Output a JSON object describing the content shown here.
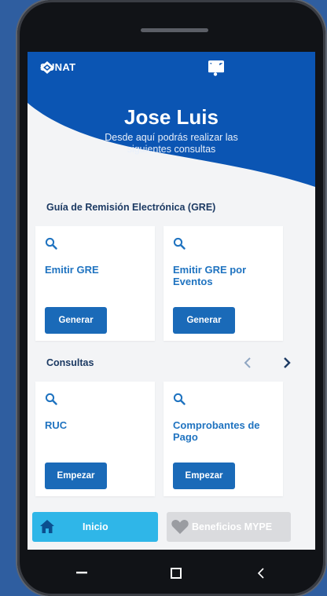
{
  "app": {
    "brand": "SUNAT"
  },
  "header": {
    "user_name": "Jose Luis",
    "subtitle": "Desde aquí podrás realizar las siguientes consultas"
  },
  "gre_section": {
    "title": "Guía de Remisión Electrónica (GRE)",
    "cards": [
      {
        "title": "Emitir GRE",
        "button": "Generar",
        "icon": "search-icon"
      },
      {
        "title": "Emitir GRE por Eventos",
        "button": "Generar",
        "icon": "search-icon"
      }
    ]
  },
  "consultas_section": {
    "title": "Consultas",
    "cards": [
      {
        "title": "RUC",
        "button": "Empezar",
        "icon": "search-icon"
      },
      {
        "title": "Comprobantes de Pago",
        "button": "Empezar",
        "icon": "search-icon"
      }
    ]
  },
  "bottom_tabs": {
    "inicio": "Inicio",
    "mype": "Beneficios MYPE"
  },
  "colors": {
    "primary_blue": "#0b55b3",
    "accent_cyan": "#2fb6e8",
    "button_blue": "#1a6ab8",
    "title_blue": "#1f73c0",
    "section_navy": "#1c3a63"
  }
}
